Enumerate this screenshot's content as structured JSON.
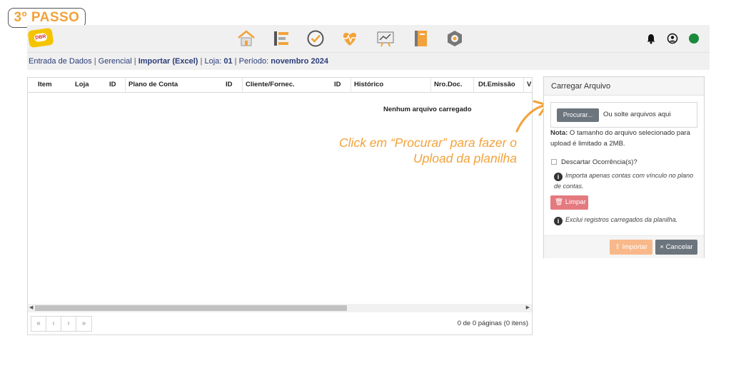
{
  "step_badge": "3º PASSO",
  "logo_text": "DBR",
  "nav_icons": [
    "home-icon",
    "list-icon",
    "check-circle-icon",
    "heart-pulse-icon",
    "chart-board-icon",
    "notebook-icon",
    "settings-hex-icon"
  ],
  "right_icons": [
    "bell-icon",
    "user-circle-icon",
    "status-dot-icon"
  ],
  "colors": {
    "accent": "#f2a23a",
    "status_online": "#1a8a3c",
    "breadcrumb": "#2a3d7a",
    "secondary_btn": "#6c757d",
    "danger_btn": "#e47a80",
    "warning_btn": "#f9b88a"
  },
  "breadcrumb": {
    "part1": "Entrada de Dados",
    "sep": " | ",
    "part2": "Gerencial",
    "part3": "Importar (Excel)",
    "loja_label": "Loja: ",
    "loja_value": "01",
    "periodo_label": "Período: ",
    "periodo_value": "novembro 2024"
  },
  "grid": {
    "columns": [
      "Item",
      "Loja",
      "ID",
      "Plano de Conta",
      "ID",
      "Cliente/Fornec.",
      "ID",
      "Histórico",
      "Nro.Doc.",
      "Dt.Emissão",
      "Vl"
    ],
    "empty_message": "Nenhum arquivo carregado",
    "page_info": "0 de 0 páginas (0 itens)",
    "pager": [
      "«",
      "‹",
      "›",
      "»"
    ]
  },
  "callout": "Click em “Procurar” para fazer o Upload da planilha",
  "panel": {
    "title": "Carregar Arquivo",
    "browse_button": "Procurar...",
    "drop_text": "Ou solte arquivos aqui",
    "note_label": "Nota:",
    "note_text": " O tamanho do arquivo selecionado para upload é limitado a 2MB.",
    "discard_label": "Descartar Ocorrência(s)?",
    "discard_hint": "Importa apenas contas com vínculo no plano de contas.",
    "clear_button": "Limpar",
    "clear_hint": "Exclui registros carregados da planilha.",
    "import_button": "Importar",
    "cancel_button": "Cancelar"
  }
}
